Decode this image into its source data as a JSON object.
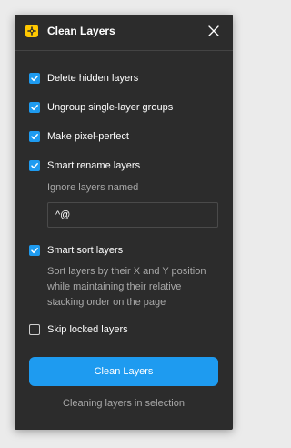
{
  "colors": {
    "accent": "#1e9bf0",
    "brand_icon": "#ffc800",
    "panel_background": "#2c2c2c",
    "page_background": "#ebebeb"
  },
  "header": {
    "title": "Clean Layers",
    "app_icon": "plugin-logo-icon",
    "close_icon": "close-icon"
  },
  "options": {
    "delete_hidden": {
      "label": "Delete hidden layers",
      "checked": true
    },
    "ungroup_single": {
      "label": "Ungroup single-layer groups",
      "checked": true
    },
    "pixel_perfect": {
      "label": "Make pixel-perfect",
      "checked": true
    },
    "smart_rename": {
      "label": "Smart rename layers",
      "checked": true,
      "ignore_label": "Ignore layers named",
      "ignore_value": "^@"
    },
    "smart_sort": {
      "label": "Smart sort layers",
      "checked": true,
      "description_lines": [
        "Sort layers by their X and Y position",
        "while maintaining their relative",
        "stacking order on the page"
      ]
    },
    "skip_locked": {
      "label": "Skip locked layers",
      "checked": false
    }
  },
  "action": {
    "button_label": "Clean Layers",
    "status": "Cleaning layers in selection"
  }
}
